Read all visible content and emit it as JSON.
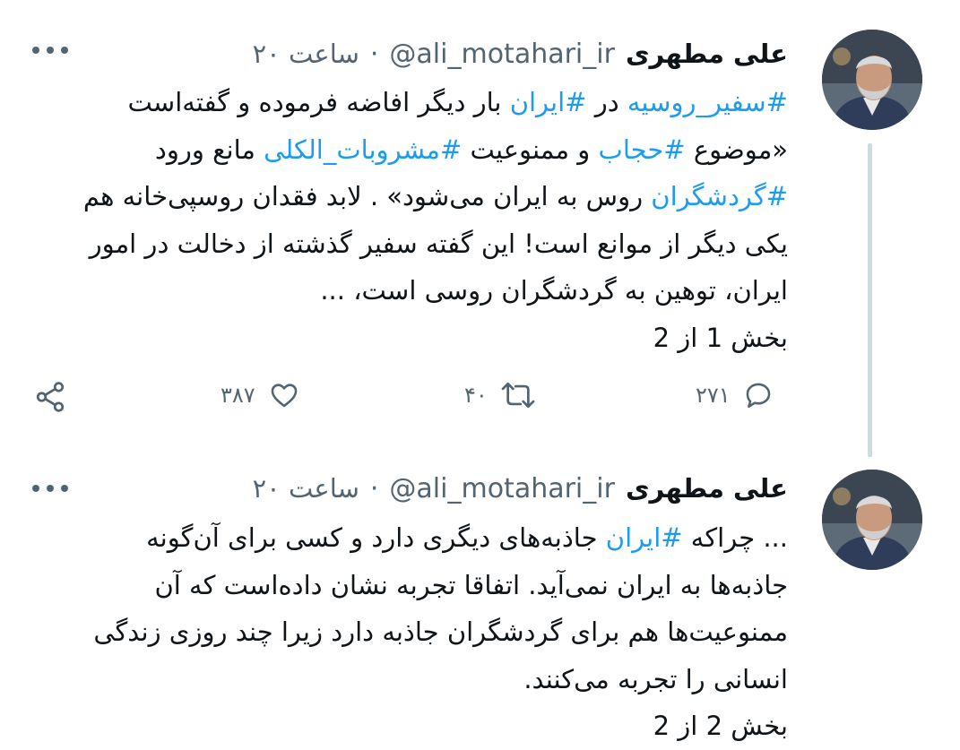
{
  "tweets": [
    {
      "name": "علی مطهری",
      "handle": "@ali_motahari_ir",
      "separator": "·",
      "time": "۲۰ ساعت",
      "lines": [
        [
          {
            "t": "#سفیر_روسیه",
            "h": true
          },
          {
            "t": " در ",
            "h": false
          },
          {
            "t": "#ایران",
            "h": true
          },
          {
            "t": " بار دیگر افاضه فرموده و گفته‌است",
            "h": false
          }
        ],
        [
          {
            "t": "«موضوع ",
            "h": false
          },
          {
            "t": "#حجاب",
            "h": true
          },
          {
            "t": " و ممنوعیت ",
            "h": false
          },
          {
            "t": "#مشروبات_الکلی",
            "h": true
          },
          {
            "t": " مانع ورود",
            "h": false
          }
        ],
        [
          {
            "t": "#گردشگران",
            "h": true
          },
          {
            "t": " روس به ایران می‌شود» . لابد فقدان روسپی‌خانه هم",
            "h": false
          }
        ],
        [
          {
            "t": "یکی دیگر از موانع است! این گفته سفیر گذشته از دخالت در امور",
            "h": false
          }
        ],
        [
          {
            "t": "ایران، توهین به گردشگران روسی است، ...",
            "h": false
          }
        ],
        [
          {
            "t": "بخش 1 از 2",
            "h": false
          }
        ]
      ],
      "actions": {
        "reply_count": "۲۷۱",
        "retweet_count": "۴۰",
        "like_count": "۳۸۷"
      }
    },
    {
      "name": "علی مطهری",
      "handle": "@ali_motahari_ir",
      "separator": "·",
      "time": "۲۰ ساعت",
      "lines": [
        [
          {
            "t": "... چراکه ",
            "h": false
          },
          {
            "t": "#ایران",
            "h": true
          },
          {
            "t": " جاذبه‌های دیگری دارد و کسی برای آن‌گونه",
            "h": false
          }
        ],
        [
          {
            "t": "جاذبه‌ها به ایران نمی‌آید. اتفاقا تجربه نشان داده‌است که آن",
            "h": false
          }
        ],
        [
          {
            "t": "ممنوعیت‌ها هم برای گردشگران جاذبه دارد زیرا چند روزی زندگی",
            "h": false
          }
        ],
        [
          {
            "t": "انسانی را تجربه می‌کنند.",
            "h": false
          }
        ],
        [
          {
            "t": "بخش 2 از 2",
            "h": false
          }
        ]
      ]
    }
  ],
  "colors": {
    "hashtag": "#1d9bf0",
    "secondary_text": "#536471",
    "thread_line": "#cfd9de"
  },
  "icons": [
    "more-icon",
    "reply-icon",
    "retweet-icon",
    "like-icon",
    "share-icon"
  ]
}
